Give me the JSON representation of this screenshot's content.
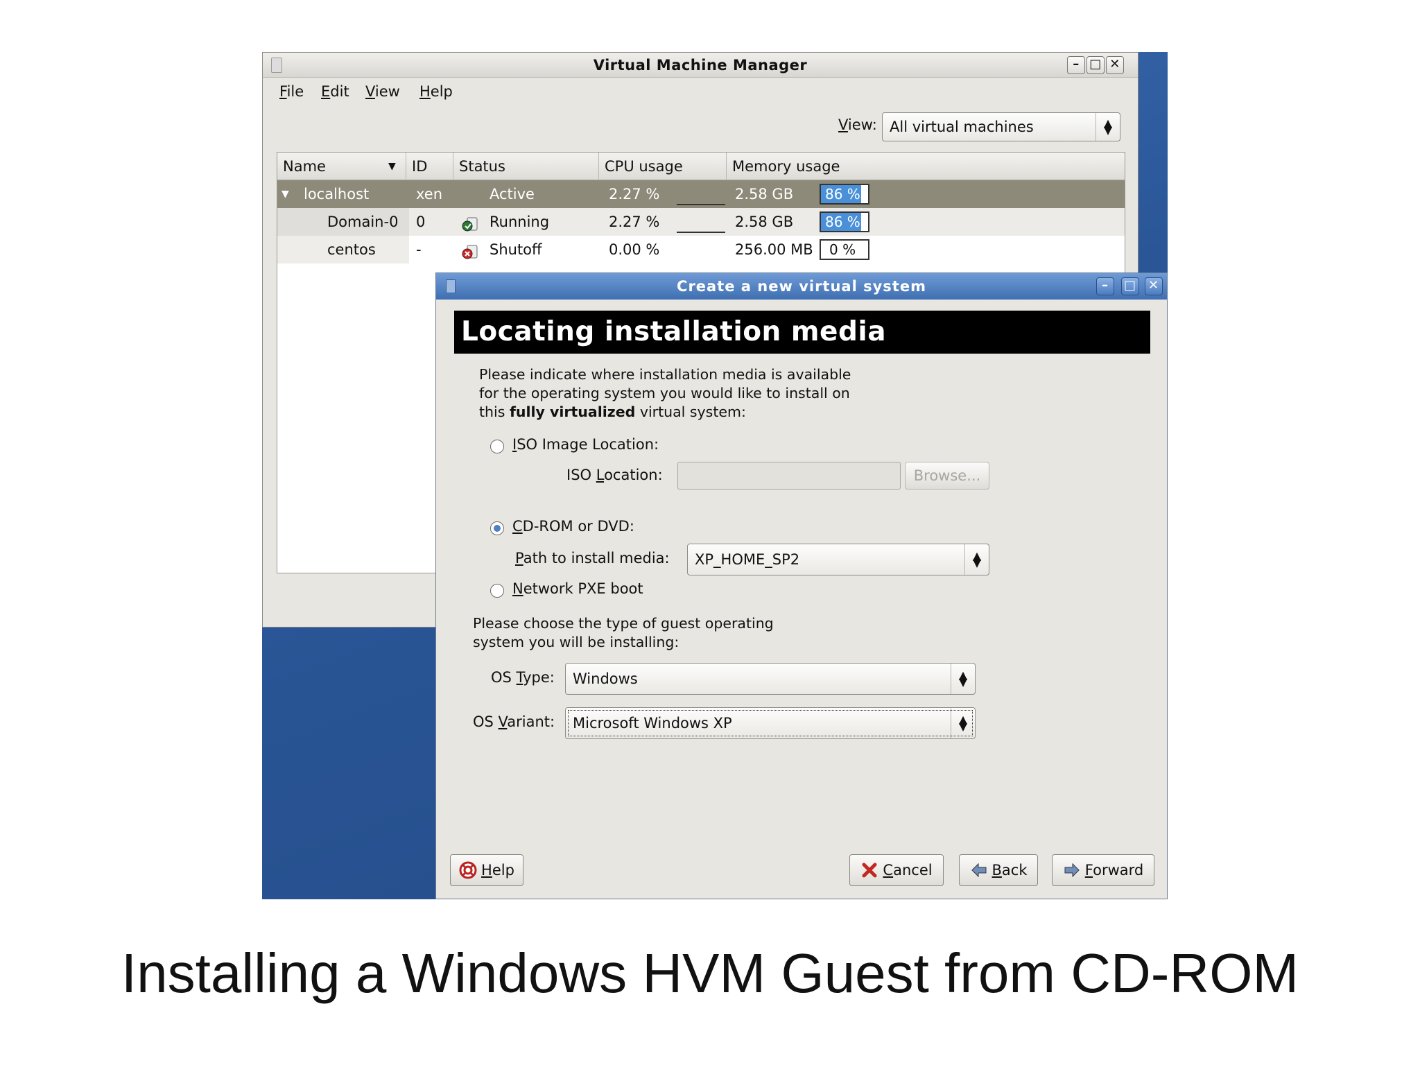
{
  "slide": {
    "caption": "Installing a Windows HVM Guest from CD-ROM"
  },
  "vmm": {
    "title": "Virtual Machine Manager",
    "menu": [
      {
        "pre": "",
        "key": "F",
        "post": "ile"
      },
      {
        "pre": "",
        "key": "E",
        "post": "dit"
      },
      {
        "pre": "",
        "key": "V",
        "post": "iew"
      },
      {
        "pre": "",
        "key": "H",
        "post": "elp"
      }
    ],
    "view_label": "View:",
    "view_label_key": "V",
    "view_label_rest": "iew:",
    "view_value": "All virtual machines",
    "columns": [
      "Name",
      "ID",
      "Status",
      "CPU usage",
      "Memory usage"
    ],
    "rows": [
      {
        "name": "localhost",
        "id": "xen",
        "status": "Active",
        "cpu": "2.27 %",
        "mem": "2.58 GB",
        "mem_pct": "86 %",
        "fill": 0.86
      },
      {
        "name": "Domain-0",
        "id": "0",
        "status": "Running",
        "cpu": "2.27 %",
        "mem": "2.58 GB",
        "mem_pct": "86 %",
        "fill": 0.86
      },
      {
        "name": "centos",
        "id": "-",
        "status": "Shutoff",
        "cpu": "0.00 %",
        "mem": "256.00 MB",
        "mem_pct": "0 %",
        "fill": 0
      }
    ]
  },
  "dialog": {
    "title": "Create a new virtual system",
    "banner": "Locating installation media",
    "intro_1": "Please indicate where installation media is available",
    "intro_2": "for the operating system you would like to install on",
    "intro_3_pre": "this ",
    "intro_3_bold": "fully virtualized",
    "intro_3_post": " virtual system:",
    "iso_radio_key": "I",
    "iso_radio_rest": "SO Image Location:",
    "iso_loc_pre": "ISO ",
    "iso_loc_key": "L",
    "iso_loc_rest": "ocation:",
    "browse": "Browse...",
    "cdrom_key": "C",
    "cdrom_rest": "D-ROM or DVD:",
    "path_key": "P",
    "path_rest": "ath to install media:",
    "path_value": "XP_HOME_SP2",
    "pxe_key": "N",
    "pxe_rest": "etwork PXE boot",
    "os_intro_1": "Please choose the type of guest operating",
    "os_intro_2": "system you will be installing:",
    "os_type_pre": "OS ",
    "os_type_key": "T",
    "os_type_rest": "ype:",
    "os_type_value": "Windows",
    "os_variant_pre": "OS ",
    "os_variant_key": "V",
    "os_variant_rest": "ariant:",
    "os_variant_value": "Microsoft Windows XP",
    "help_key": "H",
    "help_rest": "elp",
    "cancel_key": "C",
    "cancel_rest": "ancel",
    "back_key": "B",
    "back_rest": "ack",
    "forward_key": "F",
    "forward_rest": "orward"
  }
}
